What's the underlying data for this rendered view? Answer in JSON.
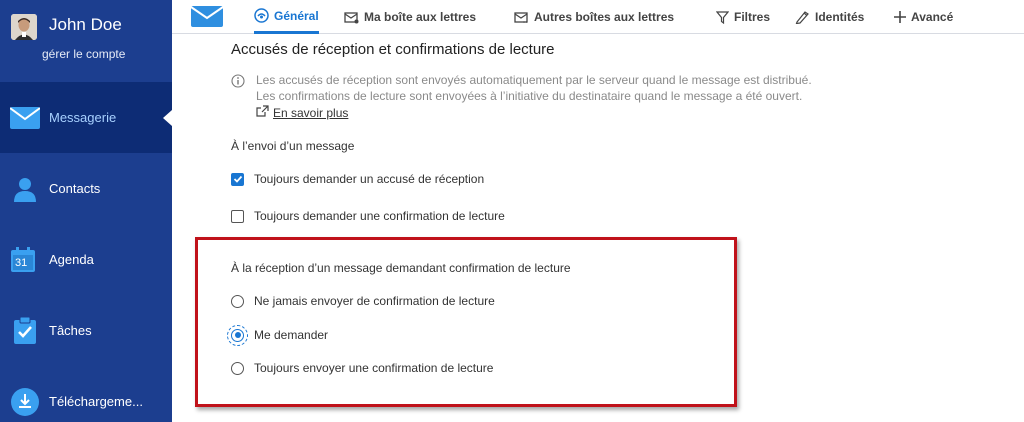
{
  "sidebar": {
    "user_name": "John Doe",
    "manage_account": "gérer le compte",
    "items": [
      {
        "label": "Messagerie",
        "icon": "mail-icon",
        "active": true
      },
      {
        "label": "Contacts",
        "icon": "contact-icon",
        "active": false
      },
      {
        "label": "Agenda",
        "icon": "calendar-icon",
        "active": false
      },
      {
        "label": "Tâches",
        "icon": "task-icon",
        "active": false
      },
      {
        "label": "Téléchargeme...",
        "icon": "download-icon",
        "active": false
      }
    ],
    "calendar_day": "31"
  },
  "topbar": {
    "tabs": [
      {
        "label": "Général",
        "icon": "general-icon",
        "active": true
      },
      {
        "label": "Ma boîte aux lettres",
        "icon": "mailbox-icon",
        "active": false
      },
      {
        "label": "Autres boîtes aux lettres",
        "icon": "other-mailboxes-icon",
        "active": false
      },
      {
        "label": "Filtres",
        "icon": "filter-icon",
        "active": false
      },
      {
        "label": "Identités",
        "icon": "identity-icon",
        "active": false
      },
      {
        "label": "Avancé",
        "icon": "plus-icon",
        "active": false
      }
    ]
  },
  "content": {
    "title": "Accusés de réception et confirmations de lecture",
    "info_line1": "Les accusés de réception sont envoyés automatiquement par le serveur quand le message est distribué.",
    "info_line2": "Les confirmations de lecture sont envoyées à l’initiative du destinataire quand le message a été ouvert.",
    "learn_more": "En savoir plus",
    "sending_label": "À l’envoi d’un message",
    "sending_options": [
      {
        "label": "Toujours demander un accusé de réception",
        "checked": true
      },
      {
        "label": "Toujours demander une confirmation de lecture",
        "checked": false
      }
    ],
    "receiving_label": "À la réception d’un message demandant confirmation de lecture",
    "receiving_options": [
      {
        "label": "Ne jamais envoyer de confirmation de lecture",
        "selected": false
      },
      {
        "label": "Me demander",
        "selected": true
      },
      {
        "label": "Toujours envoyer une confirmation de lecture",
        "selected": false
      }
    ]
  },
  "colors": {
    "sidebar_bg": "#1c3e8f",
    "sidebar_active_bg": "#0d2c75",
    "accent": "#1976d2",
    "highlight": "#c0121a"
  }
}
